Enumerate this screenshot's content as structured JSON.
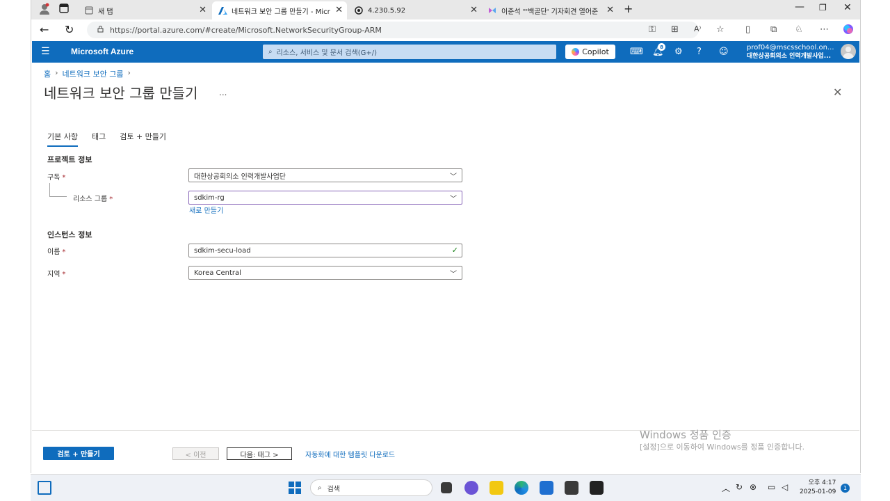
{
  "browser": {
    "tabs": [
      {
        "title": "새 탭",
        "icon": "new-tab-icon"
      },
      {
        "title": "네트워크 보안 그룹 만들기 - Micr",
        "icon": "azure-icon"
      },
      {
        "title": "4.230.5.92",
        "icon": "remote-desktop-icon"
      },
      {
        "title": "이준석 \"'백골단' 기자회견 열어준",
        "icon": "news-icon"
      }
    ],
    "url": "https://portal.azure.com/#create/Microsoft.NetworkSecurityGroup-ARM"
  },
  "azure": {
    "brand": "Microsoft Azure",
    "search_placeholder": "리소스, 서비스 및 문서 검색(G+/)",
    "copilot_label": "Copilot",
    "notification_count": "8",
    "account_email": "prof04@mscsschool.on...",
    "account_org": "대한상공회의소 인력개발사업..."
  },
  "breadcrumb": [
    "홈",
    "네트워크 보안 그룹"
  ],
  "page": {
    "title": "네트워크 보안 그룹 만들기",
    "more": "...",
    "tabs": [
      "기본 사항",
      "태그",
      "검토 + 만들기"
    ],
    "project_section": "프로젝트 정보",
    "instance_section": "인스턴스 정보",
    "fields": {
      "subscription": {
        "label": "구독",
        "value": "대한상공회의소 인력개발사업단"
      },
      "resource_group": {
        "label": "리소스 그룹",
        "value": "sdkim-rg"
      },
      "create_new": "새로 만들기",
      "name": {
        "label": "이름",
        "value": "sdkim-secu-load"
      },
      "region": {
        "label": "지역",
        "value": "Korea Central"
      }
    },
    "required_mark": "*"
  },
  "footer": {
    "review_create": "검토 + 만들기",
    "previous": "< 이전",
    "next": "다음: 태그 >",
    "download_template": "자동화에 대한 템플릿 다운로드"
  },
  "watermark": {
    "line1": "Windows 정품 인증",
    "line2": "[설정]으로 이동하여 Windows를 정품 인증합니다."
  },
  "taskbar": {
    "search_placeholder": "검색",
    "time": "오후 4:17",
    "date": "2025-01-09",
    "notifications": "1"
  },
  "colors": {
    "azure_blue": "#0f6cbd",
    "required_red": "#a4262c",
    "focus_purple": "#8764b8",
    "valid_green": "#107c10"
  }
}
